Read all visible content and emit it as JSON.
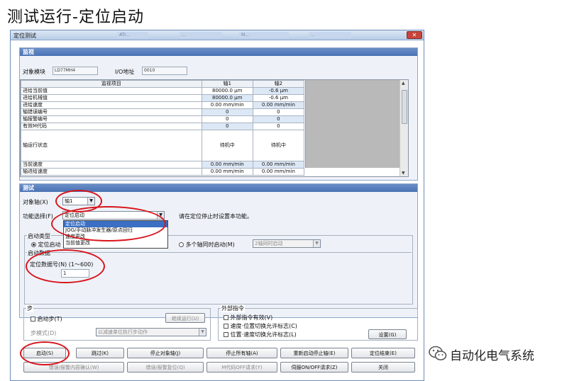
{
  "slide": {
    "title": "测试运行-定位启动"
  },
  "window": {
    "title": "定位测试",
    "bg_tabs": [
      "ATI...",
      "...",
      "M...",
      "..."
    ]
  },
  "monitor": {
    "section_title": "监视",
    "module_label": "对象模块",
    "module_value": "LD77MH4",
    "io_label": "I/O地址",
    "io_value": "0010",
    "table": {
      "headers": [
        "监视项目",
        "轴1",
        "轴2"
      ],
      "rows": [
        [
          "进给当前值",
          "80000.0 μm",
          "-0.6 μm"
        ],
        [
          "进给机械值",
          "80000.0 μm",
          "-0.6 μm"
        ],
        [
          "进给速度",
          "0.00 mm/min",
          "0.00 mm/min"
        ],
        [
          "轴错误编号",
          "0",
          "0"
        ],
        [
          "轴报警编号",
          "0",
          "0"
        ],
        [
          "有效M代码",
          "0",
          "0"
        ],
        [
          "轴运行状态",
          "待机中",
          "待机中"
        ],
        [
          "当前速度",
          "0.00 mm/min",
          "0.00 mm/min"
        ],
        [
          "轴进给速度",
          "0.00 mm/min",
          "0.00 mm/min"
        ]
      ]
    }
  },
  "test": {
    "section_title": "测试",
    "axis_label": "对象轴(X)",
    "axis_value": "轴1",
    "function_label": "功能选择(F)",
    "function_value": "定位启动",
    "function_hint": "请在定位停止时设置本功能。",
    "function_options": [
      "定位启动",
      "JOG/手动脉冲发生器/原点回归",
      "速度更改",
      "当前值更改"
    ],
    "start_type_label": "启动类型",
    "start_type_option1": "定位启动",
    "start_type_option2": "多个轴同时启动(M)",
    "simultaneous_value": "2轴同时启动",
    "start_data_label": "启动数据",
    "pos_data_label": "定位数据号(N) (1～600)",
    "pos_data_value": "1",
    "step": {
      "group_label": "步",
      "start_step_label": "启动步(T)",
      "continue_label": "继续运行(U)",
      "mode_label": "步模式(D)",
      "mode_value": "以减速单位执行步动作"
    },
    "external": {
      "group_label": "外部指令",
      "items": [
        "外部指令有效(V)",
        "速度·位置切换允许标志(C)",
        "位置·速度切换允许标志(L)"
      ],
      "settings_label": "设置(G)"
    },
    "buttons_row1": [
      "启动(S)",
      "跳过(K)",
      "停止对象轴(J)",
      "停止所有轴(A)",
      "重新启动停止轴(E)",
      "定位结束(E)"
    ],
    "buttons_row2": [
      "错误/报警内容确认(W)",
      "错误/报警复位(Q)",
      "M代码OFF请求(Y)",
      "伺服ON/OFF请求(Z)",
      "关闭"
    ]
  },
  "watermark": {
    "text": "自动化电气系统",
    "icon": "wechat-logo-icon"
  },
  "colors": {
    "section_header": "#4a72b4",
    "annotation": "#d8141c",
    "selection": "#3a6fc4"
  }
}
